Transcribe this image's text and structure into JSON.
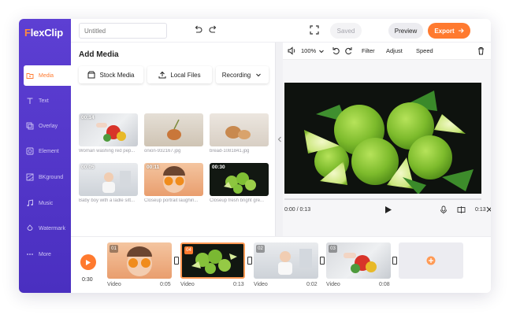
{
  "app": {
    "logo": "lexClip",
    "logo_f": "F"
  },
  "sidebar": {
    "items": [
      {
        "label": "Media",
        "icon": "folder-icon"
      },
      {
        "label": "Text",
        "icon": "text-icon"
      },
      {
        "label": "Overlay",
        "icon": "overlay-icon"
      },
      {
        "label": "Element",
        "icon": "element-icon"
      },
      {
        "label": "BKground",
        "icon": "background-icon"
      },
      {
        "label": "Music",
        "icon": "music-icon"
      },
      {
        "label": "Watermark",
        "icon": "watermark-icon"
      },
      {
        "label": "More",
        "icon": "more-icon"
      }
    ]
  },
  "topbar": {
    "title_placeholder": "Untitled",
    "saved": "Saved",
    "preview": "Preview",
    "export": "Export"
  },
  "media": {
    "title": "Add Media",
    "stock": "Stock Media",
    "local": "Local Files",
    "recording": "Recording",
    "thumbs": [
      {
        "dur": "00:14",
        "caption": "Woman washing red pep..."
      },
      {
        "dur": "",
        "caption": "onion-932167.jpg"
      },
      {
        "dur": "",
        "caption": "bread-1081841.jpg"
      },
      {
        "dur": "00:05",
        "caption": "Baby boy with a ladle sitt..."
      },
      {
        "dur": "00:11",
        "caption": "Closeup portrait laughin..."
      },
      {
        "dur": "00:30",
        "caption": "Closeup fresh bright gre..."
      }
    ]
  },
  "preview": {
    "volume": "100%",
    "filter": "Filter",
    "adjust": "Adjust",
    "speed": "Speed",
    "time": "0:00 / 0:13",
    "clip_time": "0:13"
  },
  "timeline": {
    "total": "0:30",
    "clips": [
      {
        "num": "01",
        "label": "Video",
        "dur": "0:05"
      },
      {
        "num": "04",
        "label": "Video",
        "dur": "0:13"
      },
      {
        "num": "02",
        "label": "Video",
        "dur": "0:02"
      },
      {
        "num": "03",
        "label": "Video",
        "dur": "0:08"
      }
    ]
  },
  "colors": {
    "sidebar": "#5d3fd3",
    "accent": "#ff7a2f"
  }
}
